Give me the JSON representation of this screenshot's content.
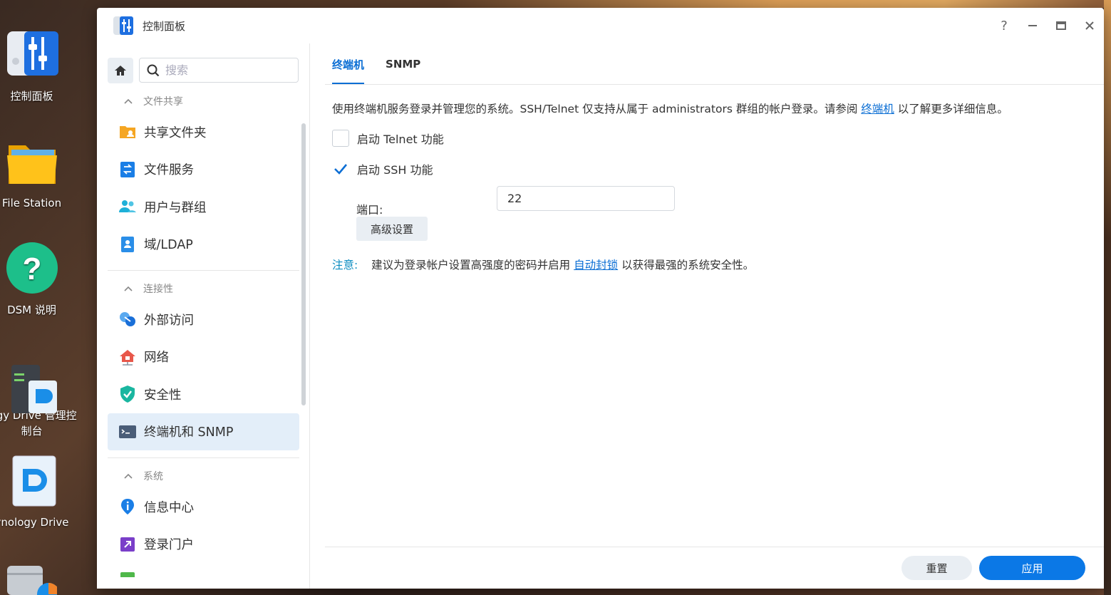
{
  "desktop": {
    "icons": [
      {
        "label": "控制面板"
      },
      {
        "label": "File Station"
      },
      {
        "label": "DSM 说明"
      },
      {
        "label": "logy Drive 管理控\n制台"
      },
      {
        "label": "ynology Drive"
      }
    ]
  },
  "window": {
    "title": "控制面板",
    "controls": {
      "help": "?",
      "minimize": "—",
      "maximize": "▭",
      "close": "✕"
    }
  },
  "sidebar": {
    "search_placeholder": "搜索",
    "sections": [
      {
        "title": "文件共享",
        "items": [
          "共享文件夹",
          "文件服务",
          "用户与群组",
          "域/LDAP"
        ]
      },
      {
        "title": "连接性",
        "items": [
          "外部访问",
          "网络",
          "安全性",
          "终端机和 SNMP"
        ]
      },
      {
        "title": "系统",
        "items": [
          "信息中心",
          "登录门户"
        ]
      }
    ],
    "active_item": "终端机和 SNMP"
  },
  "tabs": [
    {
      "label": "终端机",
      "active": true
    },
    {
      "label": "SNMP",
      "active": false
    }
  ],
  "terminal": {
    "description_pre": "使用终端机服务登录并管理您的系统。SSH/Telnet 仅支持从属于 administrators 群组的帐户登录。请参阅",
    "description_link": "终端机",
    "description_post": "以了解更多详细信息。",
    "telnet_label": "启动 Telnet 功能",
    "telnet_checked": false,
    "ssh_label": "启动 SSH 功能",
    "ssh_checked": true,
    "port_label": "端口:",
    "port_value": "22",
    "advanced_button": "高级设置",
    "note_label": "注意:",
    "note_pre": "建议为登录帐户设置高强度的密码并启用",
    "note_link": "自动封锁",
    "note_post": "以获得最强的系统安全性。"
  },
  "footer": {
    "reset_label": "重置",
    "apply_label": "应用"
  },
  "colors": {
    "accent": "#0b78e6",
    "link": "#0b6ed4",
    "active_bg": "#e3eef9"
  }
}
